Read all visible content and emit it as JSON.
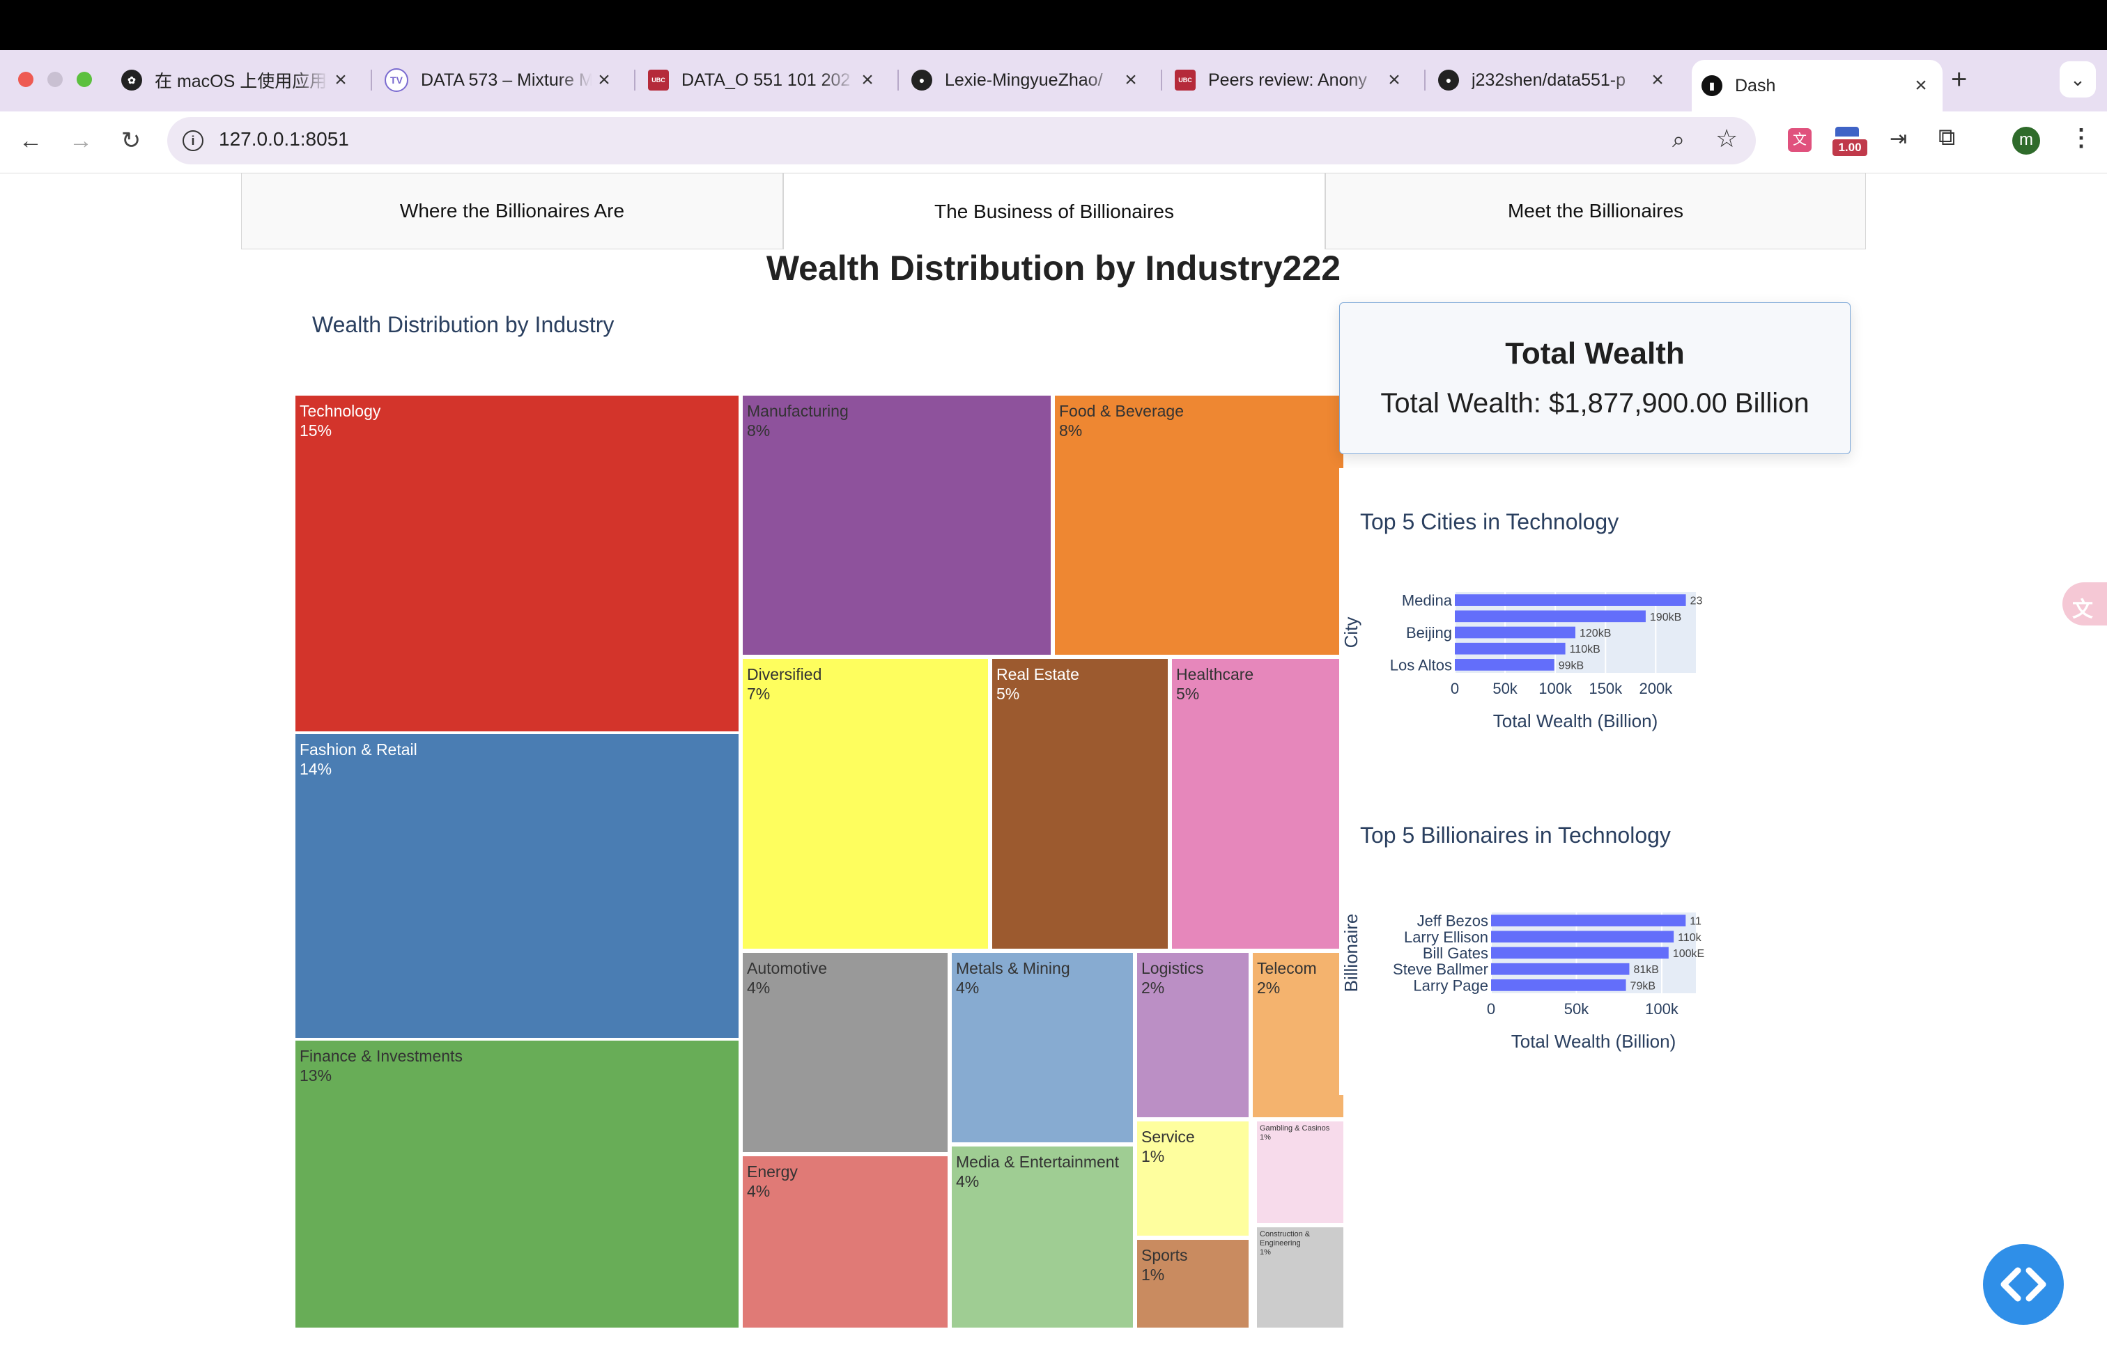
{
  "browser": {
    "tabs": [
      {
        "label": "在 macOS 上使用应用",
        "icon": "openai-icon",
        "active": false
      },
      {
        "label": "DATA 573 – Mixture M",
        "icon": "tv-icon",
        "active": false
      },
      {
        "label": "DATA_O 551 101 202",
        "icon": "ubc-icon",
        "active": false
      },
      {
        "label": "Lexie-MingyueZhao/",
        "icon": "github-icon",
        "active": false
      },
      {
        "label": "Peers review: Anony",
        "icon": "ubc-icon",
        "active": false
      },
      {
        "label": "j232shen/data551-p",
        "icon": "github-icon",
        "active": false
      },
      {
        "label": "Dash",
        "icon": "dash-icon",
        "active": true
      }
    ],
    "url": "127.0.0.1:8051",
    "badge_value": "1.00",
    "profile_initial": "m",
    "colors": {
      "tabstrip": "#e8dff2",
      "accent": "#6b4fbb"
    }
  },
  "nav_tabs": [
    {
      "label": "Where the Billionaires Are",
      "selected": false
    },
    {
      "label": "The Business of Billionaires",
      "selected": true
    },
    {
      "label": "Meet the Billionaires",
      "selected": false
    }
  ],
  "page_title": "Wealth Distribution by Industry222",
  "treemap": {
    "title": "Wealth Distribution by Industry",
    "tiles": [
      {
        "name": "Technology",
        "pct": "15%",
        "color": "#d3342b"
      },
      {
        "name": "Fashion & Retail",
        "pct": "14%",
        "color": "#4a7db3"
      },
      {
        "name": "Finance & Investments",
        "pct": "13%",
        "color": "#68ad57"
      },
      {
        "name": "Manufacturing",
        "pct": "8%",
        "color": "#8e529c"
      },
      {
        "name": "Food & Beverage",
        "pct": "8%",
        "color": "#ee8732"
      },
      {
        "name": "Diversified",
        "pct": "7%",
        "color": "#fefe5e"
      },
      {
        "name": "Real Estate",
        "pct": "5%",
        "color": "#9c5a2f"
      },
      {
        "name": "Healthcare",
        "pct": "5%",
        "color": "#e687bb"
      },
      {
        "name": "Automotive",
        "pct": "4%",
        "color": "#999999"
      },
      {
        "name": "Metals & Mining",
        "pct": "4%",
        "color": "#87abd1"
      },
      {
        "name": "Energy",
        "pct": "4%",
        "color": "#e07a76"
      },
      {
        "name": "Media & Entertainment",
        "pct": "4%",
        "color": "#9fcd93"
      },
      {
        "name": "Logistics",
        "pct": "2%",
        "color": "#bb8fc5"
      },
      {
        "name": "Telecom",
        "pct": "2%",
        "color": "#f4b36e"
      },
      {
        "name": "Service",
        "pct": "1%",
        "color": "#fefe9e"
      },
      {
        "name": "Gambling & Casinos",
        "pct": "1%",
        "color": "#f7dbeb"
      },
      {
        "name": "Sports",
        "pct": "1%",
        "color": "#c98b60"
      },
      {
        "name": "Construction & Engineering",
        "pct": "1%",
        "color": "#cccccc"
      }
    ]
  },
  "total_wealth": {
    "heading": "Total Wealth",
    "value_text": "Total Wealth: $1,877,900.00 Billion"
  },
  "chart_data": [
    {
      "type": "bar",
      "orientation": "horizontal",
      "title": "Top 5 Cities in Technology",
      "xlabel": "Total Wealth (Billion)",
      "ylabel": "City",
      "categories": [
        "Medina",
        "",
        "Beijing",
        "",
        "Los Altos"
      ],
      "values": [
        230000,
        190000,
        120000,
        110000,
        99000
      ],
      "data_labels": [
        "23",
        "190kB",
        "120kB",
        "110kB",
        "99kB"
      ],
      "xticks": [
        "0",
        "50k",
        "100k",
        "150k",
        "200k"
      ],
      "xtick_values": [
        0,
        50000,
        100000,
        150000,
        200000
      ],
      "xlim": [
        0,
        240000
      ],
      "color": "#636efa"
    },
    {
      "type": "bar",
      "orientation": "horizontal",
      "title": "Top 5 Billionaires in Technology",
      "xlabel": "Total Wealth (Billion)",
      "ylabel": "Billionaire",
      "categories": [
        "Jeff Bezos",
        "Larry Ellison",
        "Bill Gates",
        "Steve Ballmer",
        "Larry Page"
      ],
      "values": [
        114000,
        107000,
        104000,
        81000,
        79000
      ],
      "data_labels": [
        "11",
        "110k",
        "100kE",
        "81kB",
        "79kB"
      ],
      "xticks": [
        "0",
        "50k",
        "100k"
      ],
      "xtick_values": [
        0,
        50000,
        100000
      ],
      "xlim": [
        0,
        120000
      ],
      "color": "#636efa"
    }
  ]
}
